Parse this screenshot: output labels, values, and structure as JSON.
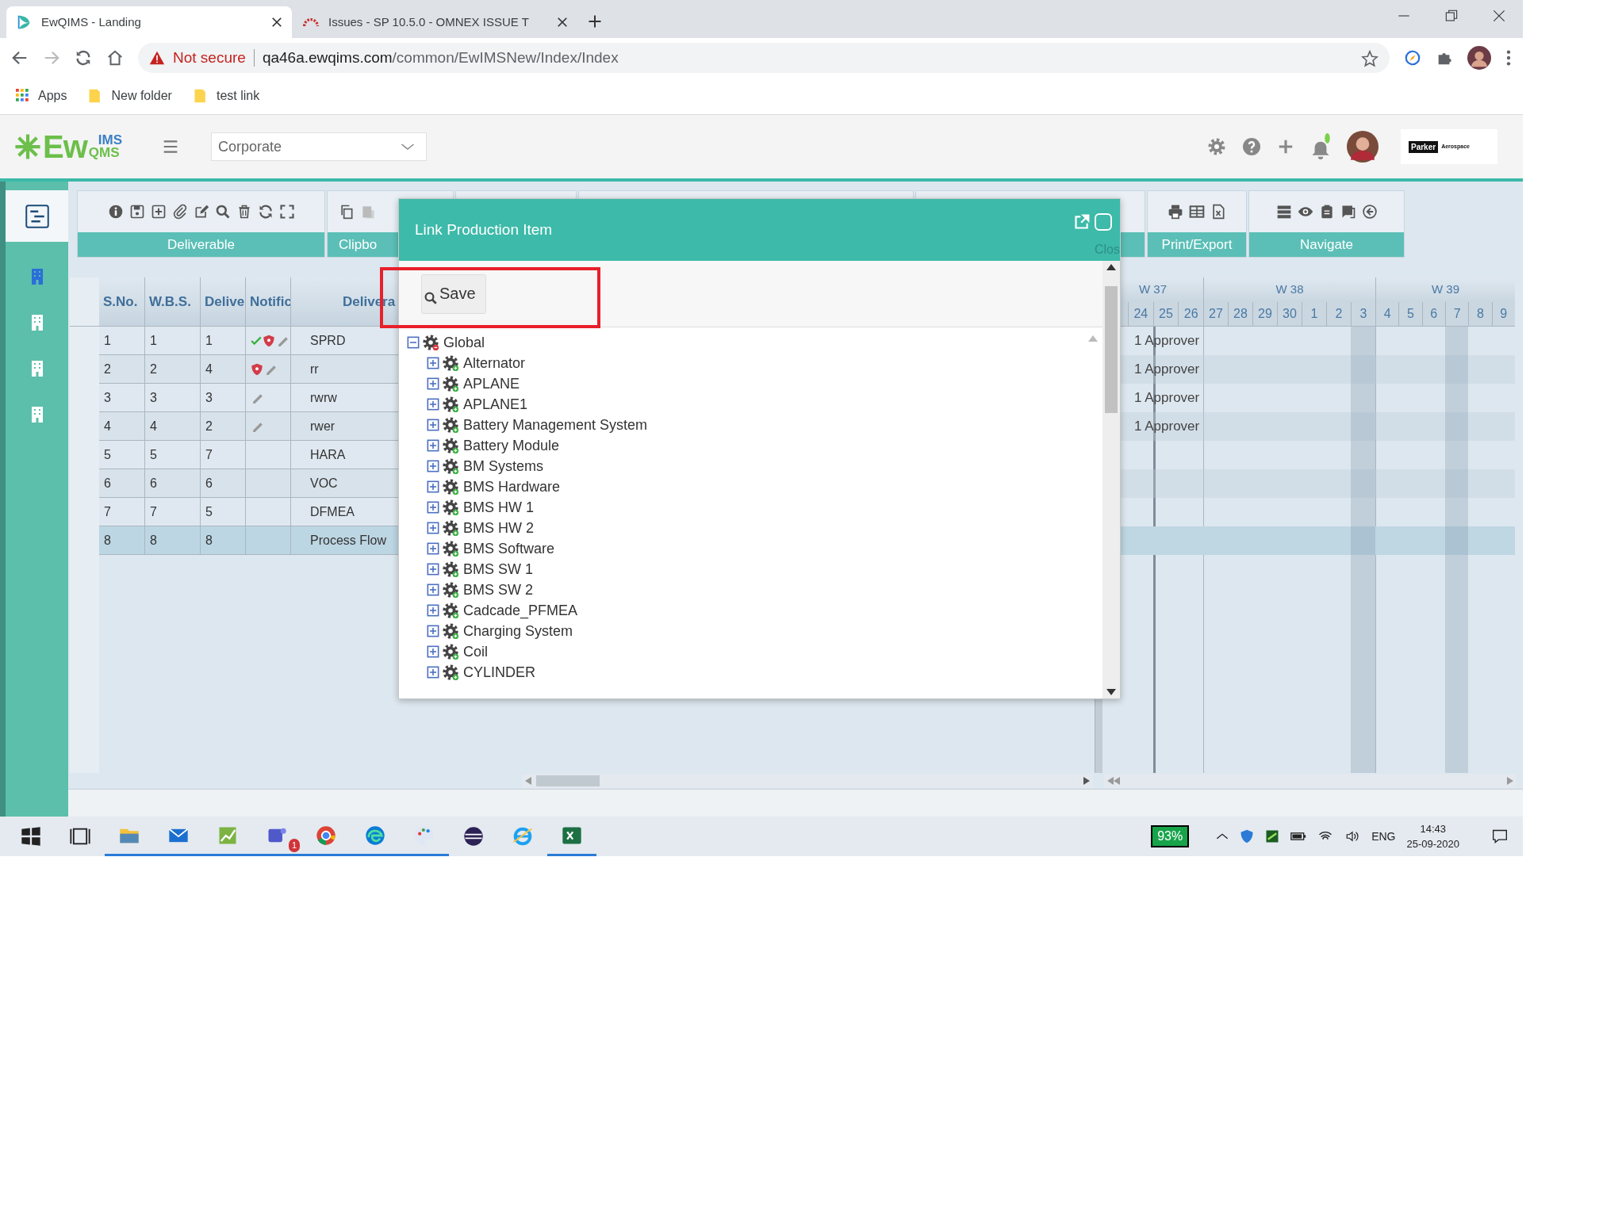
{
  "browser": {
    "tabs": [
      {
        "title": "EwQIMS - Landing",
        "selected": true
      },
      {
        "title": "Issues - SP 10.5.0 - OMNEX ISSUE T",
        "selected": false
      }
    ],
    "security": "Not secure",
    "url_host": "qa46a.ewqims.com",
    "url_path": "/common/EwIMSNew/Index/Index",
    "bookmarks": [
      "Apps",
      "New folder",
      "test link"
    ]
  },
  "sidebar": {
    "items": [
      {
        "selected": true
      },
      {
        "selected": false
      },
      {
        "selected": false
      },
      {
        "selected": false
      },
      {
        "selected": false
      }
    ]
  },
  "app": {
    "logo": {
      "main": "Ew",
      "top": "IMS",
      "bottom": "QMS"
    },
    "site": "Corporate",
    "brand": {
      "name": "Parker",
      "division": "Aerospace"
    }
  },
  "toolbar": {
    "groups": [
      {
        "label": "Deliverable"
      },
      {
        "label": "Clipbo"
      },
      {
        "label": "Print/Export"
      },
      {
        "label": "Navigate"
      }
    ]
  },
  "grid": {
    "columns": [
      "S.No.",
      "W.B.S.",
      "Delive",
      "Notific",
      "Delivera"
    ],
    "rows": [
      {
        "sno": "1",
        "wbs": "1",
        "order": "1",
        "name": "SPRD",
        "approved": true,
        "flagged": true,
        "attached": true,
        "selected": false
      },
      {
        "sno": "2",
        "wbs": "2",
        "order": "4",
        "name": "rr",
        "approved": false,
        "flagged": true,
        "attached": true,
        "selected": false
      },
      {
        "sno": "3",
        "wbs": "3",
        "order": "3",
        "name": "rwrw",
        "approved": false,
        "flagged": false,
        "attached": true,
        "selected": false
      },
      {
        "sno": "4",
        "wbs": "4",
        "order": "2",
        "name": "rwer",
        "approved": false,
        "flagged": false,
        "attached": true,
        "selected": false
      },
      {
        "sno": "5",
        "wbs": "5",
        "order": "7",
        "name": "HARA",
        "approved": false,
        "flagged": false,
        "attached": false,
        "selected": false
      },
      {
        "sno": "6",
        "wbs": "6",
        "order": "6",
        "name": "VOC",
        "approved": false,
        "flagged": false,
        "attached": false,
        "selected": false
      },
      {
        "sno": "7",
        "wbs": "7",
        "order": "5",
        "name": "DFMEA",
        "approved": false,
        "flagged": false,
        "attached": false,
        "selected": false
      },
      {
        "sno": "8",
        "wbs": "8",
        "order": "8",
        "name": "Process Flow",
        "approved": false,
        "flagged": false,
        "attached": false,
        "selected": true
      }
    ]
  },
  "gantt": {
    "weeks": [
      {
        "label": "W 37",
        "days": [
          {
            "label": "24",
            "shaded": false,
            "today": false
          },
          {
            "label": "25",
            "shaded": false,
            "today": true
          },
          {
            "label": "26",
            "shaded": false,
            "today": false
          }
        ]
      },
      {
        "label": "W 38",
        "days": [
          {
            "label": "27",
            "shaded": false,
            "today": false
          },
          {
            "label": "28",
            "shaded": false,
            "today": false
          },
          {
            "label": "29",
            "shaded": false,
            "today": false
          },
          {
            "label": "30",
            "shaded": false,
            "today": false
          },
          {
            "label": "1",
            "shaded": false,
            "today": false
          },
          {
            "label": "2",
            "shaded": false,
            "today": false
          },
          {
            "label": "3",
            "shaded": true,
            "today": false
          }
        ]
      },
      {
        "label": "W 39",
        "days": [
          {
            "label": "4",
            "shaded": false,
            "today": false
          },
          {
            "label": "5",
            "shaded": false,
            "today": false
          },
          {
            "label": "6",
            "shaded": false,
            "today": false
          },
          {
            "label": "7",
            "shaded": true,
            "today": false
          },
          {
            "label": "8",
            "shaded": false,
            "today": false
          },
          {
            "label": "9",
            "shaded": false,
            "today": false
          }
        ]
      }
    ],
    "row_labels": [
      "1 Approver",
      "1 Approver",
      "1 Approver",
      "1 Approver"
    ]
  },
  "dialog": {
    "title": "Link Production Item",
    "close_hint": "Clos",
    "save": "Save",
    "tree": [
      {
        "label": "Global",
        "expanded": true,
        "children": [
          {
            "label": "Alternator",
            "expanded": false
          },
          {
            "label": "APLANE",
            "expanded": false
          },
          {
            "label": "APLANE1",
            "expanded": false
          },
          {
            "label": "Battery Management System",
            "expanded": false
          },
          {
            "label": "Battery Module",
            "expanded": false
          },
          {
            "label": "BM Systems",
            "expanded": false
          },
          {
            "label": "BMS Hardware",
            "expanded": false
          },
          {
            "label": "BMS HW 1",
            "expanded": false
          },
          {
            "label": "BMS HW 2",
            "expanded": false
          },
          {
            "label": "BMS Software",
            "expanded": false
          },
          {
            "label": "BMS SW 1",
            "expanded": false
          },
          {
            "label": "BMS SW 2",
            "expanded": false
          },
          {
            "label": "Cadcade_PFMEA",
            "expanded": false
          },
          {
            "label": "Charging System",
            "expanded": false
          },
          {
            "label": "Coil",
            "expanded": false
          },
          {
            "label": "CYLINDER",
            "expanded": false
          }
        ]
      }
    ]
  },
  "taskbar": {
    "chat_badge": "1",
    "battery": "93%",
    "language": "ENG",
    "time": "14:43",
    "date": "25-09-2020"
  }
}
